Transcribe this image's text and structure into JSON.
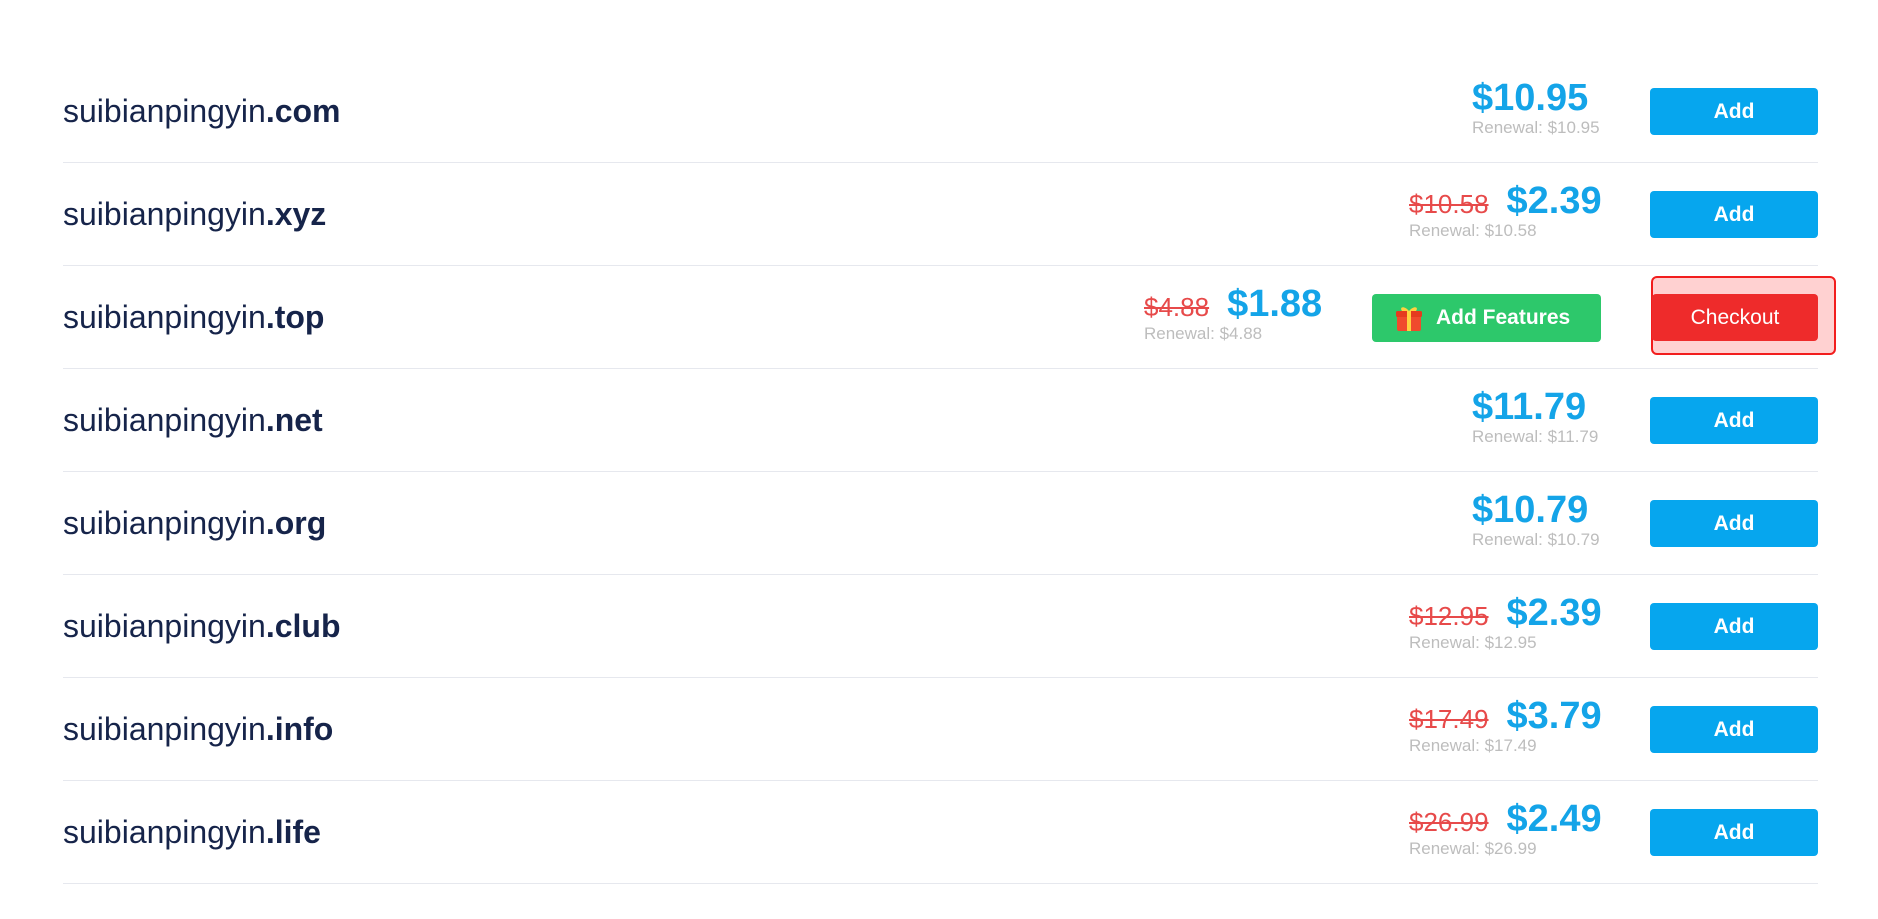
{
  "rows": [
    {
      "name": "suibianpingyin",
      "tld": ".com",
      "price": "$10.95",
      "old_price": "",
      "renewal": "Renewal: $10.95",
      "button": "Add"
    },
    {
      "name": "suibianpingyin",
      "tld": ".xyz",
      "price": "$2.39",
      "old_price": "$10.58",
      "renewal": "Renewal: $10.58",
      "button": "Add"
    },
    {
      "name": "suibianpingyin",
      "tld": ".top",
      "price": "$1.88",
      "old_price": "$4.88",
      "renewal": "Renewal: $4.88",
      "feature_button": "Add Features",
      "button": "Checkout"
    },
    {
      "name": "suibianpingyin",
      "tld": ".net",
      "price": "$11.79",
      "old_price": "",
      "renewal": "Renewal: $11.79",
      "button": "Add"
    },
    {
      "name": "suibianpingyin",
      "tld": ".org",
      "price": "$10.79",
      "old_price": "",
      "renewal": "Renewal: $10.79",
      "button": "Add"
    },
    {
      "name": "suibianpingyin",
      "tld": ".club",
      "price": "$2.39",
      "old_price": "$12.95",
      "renewal": "Renewal: $12.95",
      "button": "Add"
    },
    {
      "name": "suibianpingyin",
      "tld": ".info",
      "price": "$3.79",
      "old_price": "$17.49",
      "renewal": "Renewal: $17.49",
      "button": "Add"
    },
    {
      "name": "suibianpingyin",
      "tld": ".life",
      "price": "$2.49",
      "old_price": "$26.99",
      "renewal": "Renewal: $26.99",
      "button": "Add"
    }
  ],
  "colors": {
    "domain_text": "#16244a",
    "price": "#14a4e8",
    "old_price": "#e74a4a",
    "renewal": "#bdbdbd",
    "add_button": "#06a6ee",
    "checkout_button": "#ee2b2b",
    "features_button": "#2dc86b",
    "checkout_highlight": "#ffd1d1"
  },
  "icons": {
    "features": "gift-icon"
  }
}
